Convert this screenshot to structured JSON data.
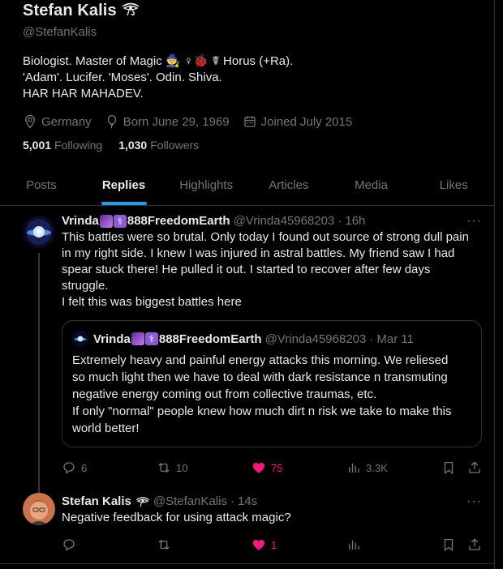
{
  "profile": {
    "display_name": "Stefan Kalis",
    "handle": "@StefanKalis",
    "bio_lines": [
      "Biologist. Master of Magic 🧙 ♀🐞 ☤ Horus (+Ra).",
      "'Adam'. Lucifer. 'Moses'. Odin. Shiva.",
      "HAR HAR MAHADEV."
    ],
    "location": "Germany",
    "born": "Born June 29, 1969",
    "joined": "Joined July 2015",
    "following_count": "5,001",
    "following_label": "Following",
    "followers_count": "1,030",
    "followers_label": "Followers"
  },
  "tabs": [
    {
      "label": "Posts",
      "active": false
    },
    {
      "label": "Replies",
      "active": true
    },
    {
      "label": "Highlights",
      "active": false
    },
    {
      "label": "Articles",
      "active": false
    },
    {
      "label": "Media",
      "active": false
    },
    {
      "label": "Likes",
      "active": false
    }
  ],
  "posts": [
    {
      "name": "Vrinda",
      "name_suffix": "888FreedomEarth",
      "handle": "@Vrinda45968203",
      "time": "16h",
      "text_lines": [
        "This battles were so brutal. Only today I found out source of strong dull pain",
        "in my right side. I knew I was injured in astral battles. My friend saw I had",
        "spear stuck there! He pulled it out. I started to recover after few days",
        "struggle.",
        "I felt this was biggest battles here"
      ],
      "quote": {
        "name": "Vrinda",
        "name_suffix": "888FreedomEarth",
        "handle": "@Vrinda45968203",
        "time": "Mar 11",
        "text_lines": [
          "Extremely heavy and painful energy attacks this morning. We reliesed",
          "so much light then we have to deal with dark resistance n transmuting",
          "negative energy coming out from collective traumas, etc.",
          "If only \"normal\" people knew how much dirt n risk we take to make this",
          "world better!"
        ]
      },
      "replies": "6",
      "reposts": "10",
      "likes": "75",
      "views": "3.3K"
    },
    {
      "name": "Stefan Kalis",
      "handle": "@StefanKalis",
      "time": "14s",
      "text_lines": [
        "Negative feedback for using attack magic?"
      ],
      "replies": "",
      "reposts": "",
      "likes": "1",
      "views": ""
    }
  ],
  "colors": {
    "accent": "#1d9bf0",
    "like": "#f91880",
    "muted": "#71767b",
    "text": "#e7e9ea",
    "border": "#2f3336"
  }
}
